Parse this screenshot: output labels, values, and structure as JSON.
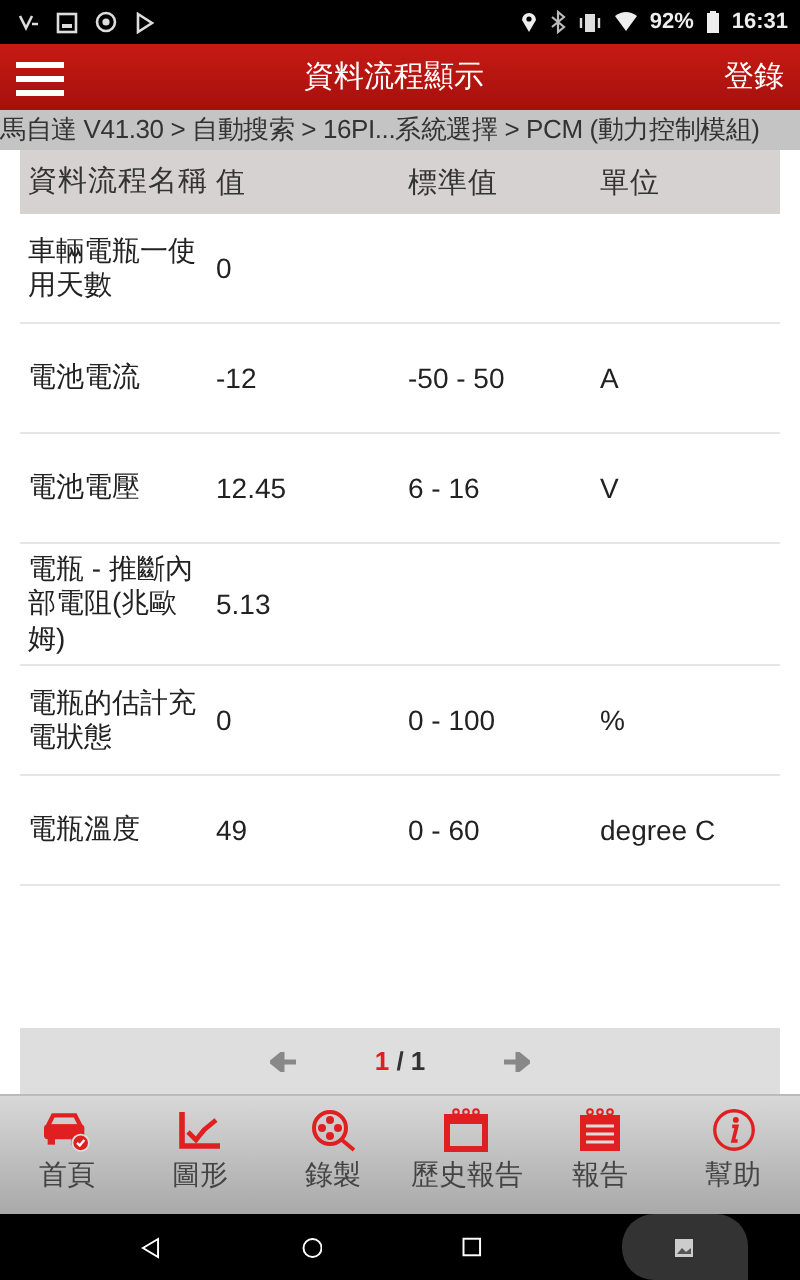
{
  "status_bar": {
    "battery": "92%",
    "time": "16:31"
  },
  "header": {
    "title": "資料流程顯示",
    "action": "登錄"
  },
  "breadcrumb": "馬自達 V41.30 > 自動搜索 > 16PI...系統選擇 > PCM (動力控制模組)",
  "table": {
    "columns": [
      "資料流程名稱",
      "值",
      "標準值",
      "單位"
    ],
    "rows": [
      {
        "name": "車輛電瓶一使用天數",
        "value": "0",
        "range": "",
        "unit": ""
      },
      {
        "name": "電池電流",
        "value": "-12",
        "range": "-50 - 50",
        "unit": "A"
      },
      {
        "name": "電池電壓",
        "value": "12.45",
        "range": "6 - 16",
        "unit": "V"
      },
      {
        "name": "電瓶 - 推斷內部電阻(兆歐姆)",
        "value": "5.13",
        "range": "",
        "unit": ""
      },
      {
        "name": "電瓶的估計充電狀態",
        "value": "0",
        "range": "0 - 100",
        "unit": "%"
      },
      {
        "name": "電瓶溫度",
        "value": "49",
        "range": "0 - 60",
        "unit": "degree C"
      }
    ]
  },
  "pager": {
    "current": "1",
    "separator": "/",
    "total": "1"
  },
  "bottom_nav": [
    {
      "kind": "car",
      "label": "首頁"
    },
    {
      "kind": "graph",
      "label": "圖形"
    },
    {
      "kind": "record",
      "label": "錄製"
    },
    {
      "kind": "calendar",
      "label": "歷史報告"
    },
    {
      "kind": "report",
      "label": "報告"
    },
    {
      "kind": "info",
      "label": "幫助"
    }
  ]
}
